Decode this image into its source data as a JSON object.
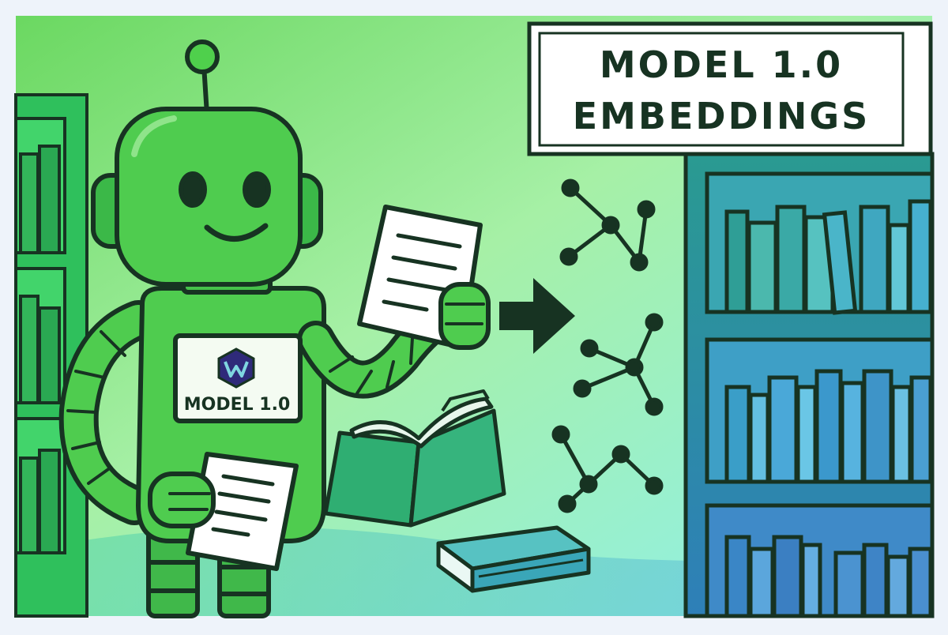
{
  "sign": {
    "line1": "MODEL 1.0",
    "line2": "EMBEDDINGS"
  },
  "robot": {
    "badge_label": "MODEL 1.0"
  },
  "colors": {
    "background_left": "#86e27e",
    "background_right": "#8ef3ef",
    "robot_green": "#4fcc4f",
    "shelf_blue": "#2f9fb8",
    "outline": "#173322",
    "badge_logo": "#2f2a7a"
  },
  "icons": [
    "robot",
    "document-icon",
    "arrow-right-icon",
    "graph-icon",
    "book-icon",
    "bookshelf"
  ]
}
